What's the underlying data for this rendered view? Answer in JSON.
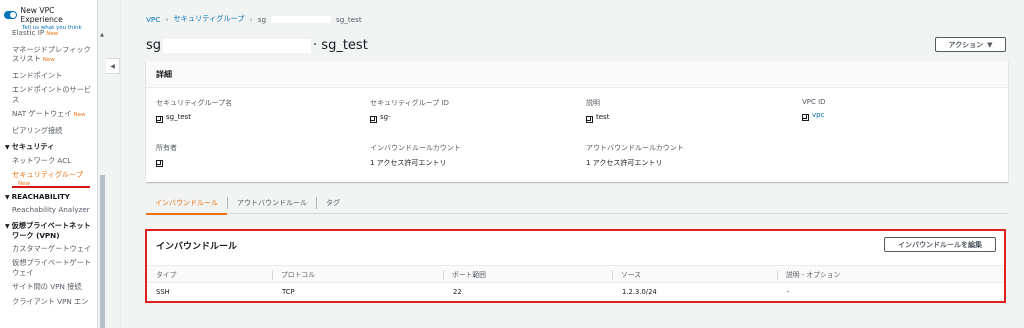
{
  "sidebar": {
    "vpc_experience": {
      "title": "New VPC Experience",
      "subtitle": "Tell us what you think"
    },
    "items": [
      {
        "label": "Elastic IP",
        "new": "New"
      },
      {
        "label": "マネージドプレフィック"
      },
      {
        "label": "スリスト",
        "new": "New"
      },
      {
        "label": "エンドポイント"
      },
      {
        "label": "エンドポイントのサービ"
      },
      {
        "label": "ス"
      },
      {
        "label": "NAT ゲートウェイ",
        "new": "New"
      },
      {
        "label": "ピアリング接続"
      }
    ],
    "security_head": "セキュリティ",
    "security_items": [
      {
        "label": "ネットワーク ACL"
      },
      {
        "label": "セキュリティグループ",
        "new": "New"
      }
    ],
    "reachability_head": "REACHABILITY",
    "reachability_items": [
      {
        "label": "Reachability Analyzer"
      }
    ],
    "vpn_head_line1": "仮想プライベートネット",
    "vpn_head_line2": "ワーク (VPN)",
    "vpn_items": [
      {
        "label": "カスタマーゲートウェイ"
      },
      {
        "label": "仮想プライベートゲート"
      },
      {
        "label": "ウェイ"
      },
      {
        "label": "サイト間の VPN 接続"
      },
      {
        "label": "クライアント VPN エン"
      }
    ]
  },
  "breadcrumb": {
    "root": "VPC",
    "parent": "セキュリティグループ",
    "current_prefix": "sg",
    "current_suffix": "sg_test"
  },
  "page": {
    "title_prefix": "sg",
    "title_suffix": "· sg_test",
    "action_label": "アクション"
  },
  "details": {
    "header": "詳細",
    "fields": {
      "sg_name": {
        "label": "セキュリティグループ名",
        "value": "sg_test"
      },
      "sg_id": {
        "label": "セキュリティグループ ID",
        "value": "sg-"
      },
      "description": {
        "label": "説明",
        "value": "test"
      },
      "vpc_id": {
        "label": "VPC ID",
        "value": "vpc"
      },
      "owner": {
        "label": "所有者",
        "value": ""
      },
      "inbound_count": {
        "label": "インバウンドルールカウント",
        "value": "1 アクセス許可エントリ"
      },
      "outbound_count": {
        "label": "アウトバウンドルールカウント",
        "value": "1 アクセス許可エントリ"
      }
    }
  },
  "tabs": {
    "inbound": "インバウンドルール",
    "outbound": "アウトバウンドルール",
    "tags": "タグ"
  },
  "inbound_rules": {
    "title": "インバウンドルール",
    "edit_label": "インバウンドルールを編集",
    "columns": [
      "タイプ",
      "プロトコル",
      "ポート範囲",
      "ソース",
      "説明 - オプション"
    ],
    "rows": [
      [
        "SSH",
        "TCP",
        "22",
        "1.2.3.0/24",
        "-"
      ]
    ]
  },
  "colors": {
    "accent": "#ec7211",
    "link": "#0073bb",
    "highlight": "#e02020"
  }
}
